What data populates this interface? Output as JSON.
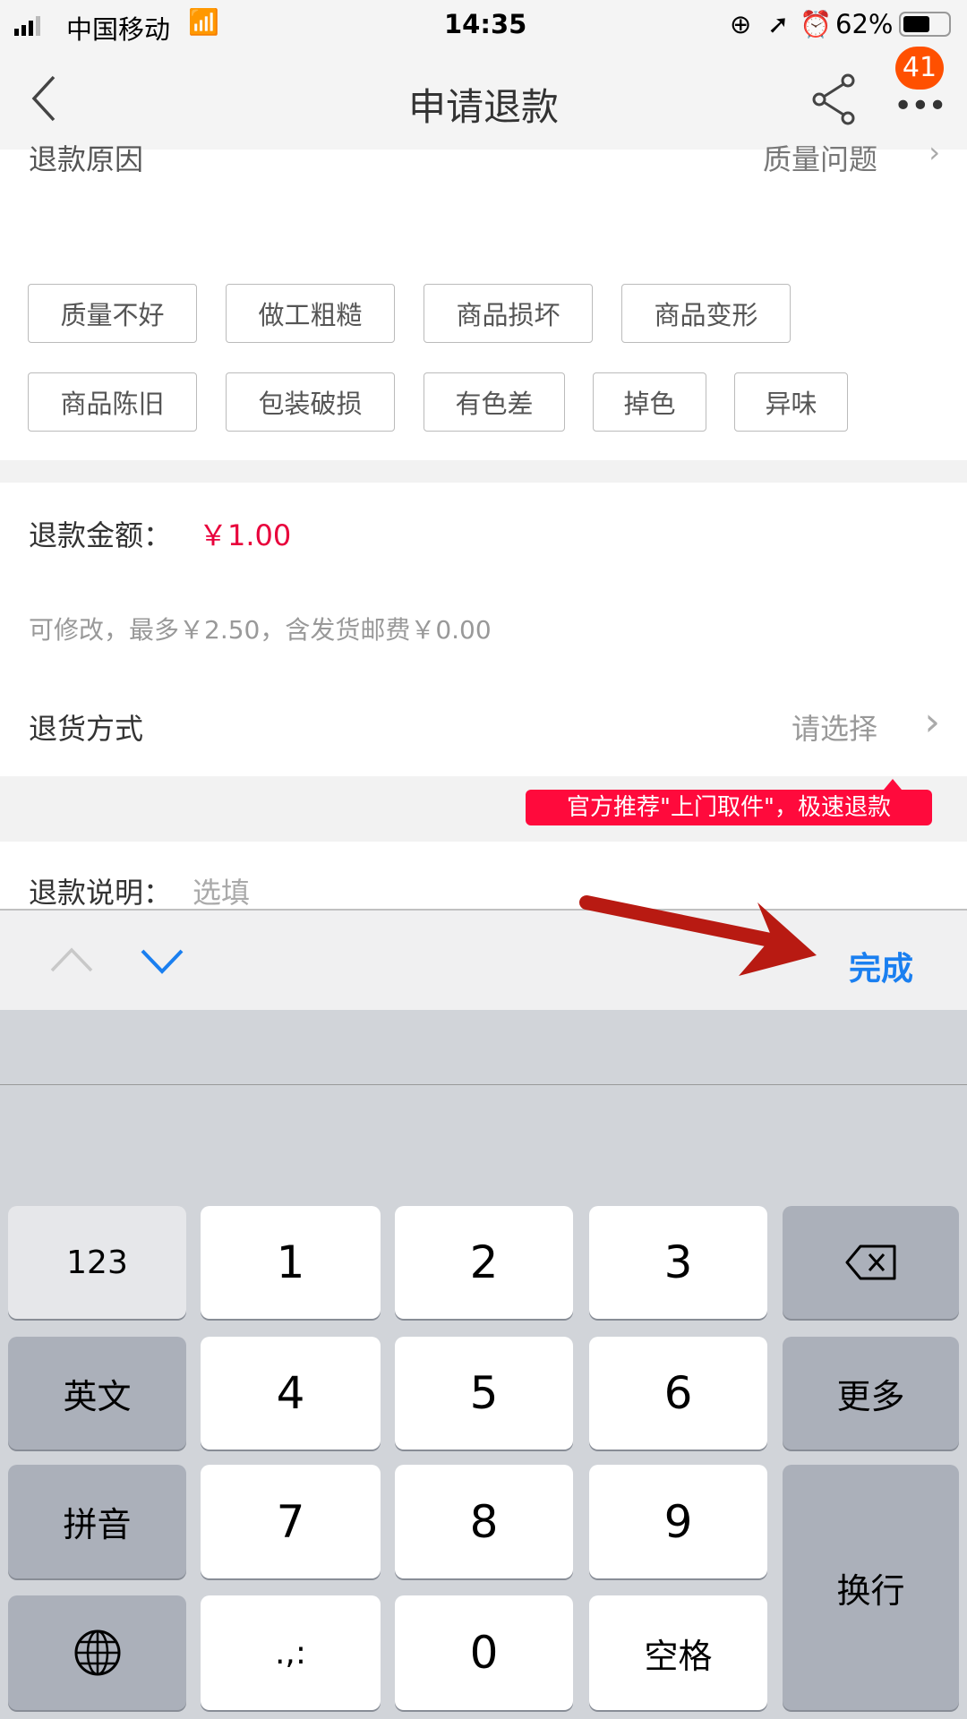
{
  "status_bar": {
    "carrier": "中国移动",
    "time": "14:35",
    "battery": "62%"
  },
  "nav": {
    "title": "申请退款",
    "badge": "41"
  },
  "reason": {
    "label": "退款原因",
    "value": "质量问题"
  },
  "tags": [
    "质量不好",
    "做工粗糙",
    "商品损坏",
    "商品变形",
    "商品陈旧",
    "包装破损",
    "有色差",
    "掉色",
    "异味"
  ],
  "amount": {
    "label": "退款金额：",
    "value": "￥1.00",
    "hint": "可修改，最多￥2.50，含发货邮费￥0.00"
  },
  "return_method": {
    "label": "退货方式",
    "value": "请选择",
    "tooltip": "官方推荐\"上门取件\"，极速退款"
  },
  "note": {
    "label": "退款说明：",
    "placeholder": "选填"
  },
  "accessory": {
    "done": "完成"
  },
  "keyboard": {
    "row1": [
      "123",
      "1",
      "2",
      "3"
    ],
    "row2": [
      "英文",
      "4",
      "5",
      "6",
      "更多"
    ],
    "row3": [
      "拼音",
      "7",
      "8",
      "9"
    ],
    "row4": [
      ".,:",
      "0",
      "空格"
    ],
    "return": "换行"
  },
  "colors": {
    "accent": "#e8003b",
    "link": "#1a7ff0",
    "badge": "#ff5000",
    "annotation_arrow": "#b81a12"
  }
}
